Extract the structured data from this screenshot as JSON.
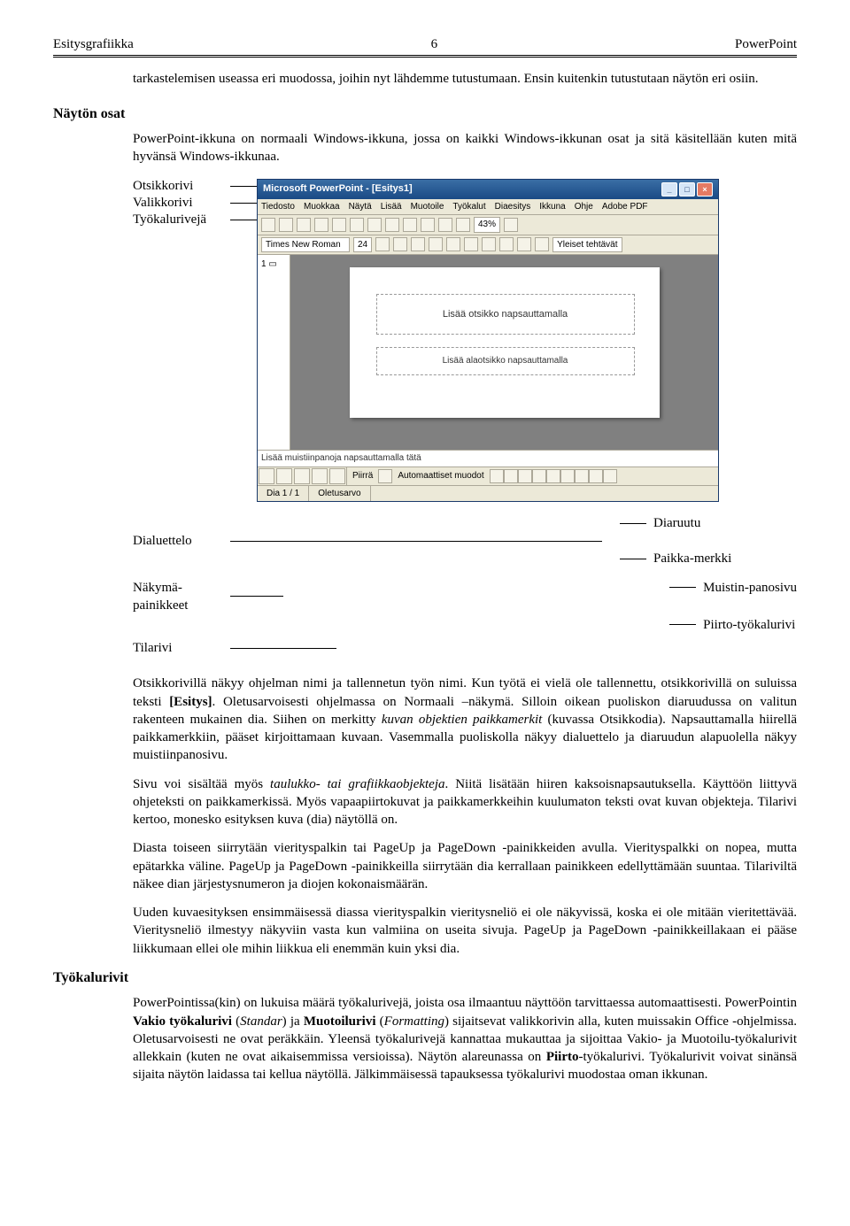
{
  "header": {
    "left": "Esitysgrafiikka",
    "center": "6",
    "right": "PowerPoint"
  },
  "intro1": "tarkastelemisen useassa eri muodossa, joihin nyt lähdemme tutustumaan. Ensin kuitenkin tutustutaan näytön eri osiin.",
  "section1": {
    "heading": "Näytön osat"
  },
  "para_window": "PowerPoint-ikkuna on normaali Windows-ikkuna, jossa on kaikki Windows-ikkunan osat ja sitä käsitellään kuten mitä hyvänsä Windows-ikkunaa.",
  "labels": {
    "otsikkorivi": "Otsikkorivi",
    "valikkorivi": "Valikkorivi",
    "tyokaluriveja": "Työkalurivejä",
    "dialuettelo": "Dialuettelo",
    "diaruutu": "Diaruutu",
    "paikkamerkki": "Paikka-merkki",
    "nakymapainikkeet": "Näkymä-painikkeet",
    "tilarivi": "Tilarivi",
    "muistinpanosivu": "Muistin-panosivu",
    "piirtotyokalurivi": "Piirto-työkalurivi"
  },
  "app": {
    "title": "Microsoft PowerPoint - [Esitys1]",
    "menu": [
      "Tiedosto",
      "Muokkaa",
      "Näytä",
      "Lisää",
      "Muotoile",
      "Työkalut",
      "Diaesitys",
      "Ikkuna",
      "Ohje",
      "Adobe PDF"
    ],
    "font": "Times New Roman",
    "size": "24",
    "zoom": "43%",
    "yleiset": "Yleiset tehtävät",
    "ph_title": "Lisää otsikko napsauttamalla",
    "ph_sub": "Lisää alaotsikko napsauttamalla",
    "notes": "Lisää muistiinpanoja napsauttamalla tätä",
    "draw_label": "Piirrä",
    "autoshapes": "Automaattiset muodot",
    "status": {
      "dia": "Dia 1 / 1",
      "layout": "Oletusarvo"
    }
  },
  "p_otsikkorivi_html": "Otsikkorivillä näkyy ohjelman nimi ja tallennetun työn nimi. Kun työtä ei vielä ole tallennettu, otsikkorivillä on suluissa teksti <b>[Esitys]</b>. Oletusarvoisesti ohjelmassa on Normaali –näkymä. Silloin oikean puoliskon diaruudussa on valitun rakenteen mukainen dia. Siihen on merkitty <i>kuvan objektien paikkamerkit</i> (kuvassa Otsikkodia). Napsauttamalla hiirellä paikkamerkkiin, pääset kirjoittamaan kuvaan. Vasemmalla puoliskolla näkyy dialuettelo ja diaruudun alapuolella näkyy muistiinpanosivu.",
  "p_sivu_html": "Sivu voi sisältää myös <i>taulukko- tai grafiikkaobjekteja</i>. Niitä lisätään hiiren kaksoisnapsautuksella. Käyttöön liittyvä ohjeteksti on paikkamerkissä. Myös vapaapiirtokuvat ja paikkamerkkeihin kuulumaton teksti ovat kuvan objekteja. Tilarivi kertoo, monesko esityksen kuva (dia) näytöllä on.",
  "p_diasta": "Diasta toiseen siirrytään vierityspalkin tai PageUp ja PageDown -painikkeiden avulla. Vierityspalkki on nopea, mutta epätarkka väline. PageUp ja PageDown -painikkeilla siirrytään dia kerrallaan painikkeen edellyttämään suuntaa. Tilariviltä näkee dian järjestysnumeron ja diojen kokonaismäärän.",
  "p_uuden": "Uuden kuvaesityksen ensimmäisessä diassa vierityspalkin vieritysneliö ei ole näkyvissä, koska ei ole mitään vieritettävää. Vieritysneliö ilmestyy näkyviin vasta kun valmiina on useita sivuja. PageUp ja PageDown -painikkeillakaan ei pääse liikkumaan ellei ole mihin liikkua eli enemmän kuin yksi dia.",
  "section2": {
    "heading": "Työkalurivit"
  },
  "p_tk_html": "PowerPointissa(kin) on lukuisa määrä työkalurivejä, joista osa ilmaantuu näyttöön tarvittaessa automaattisesti. PowerPointin <b>Vakio työkalurivi</b> (<i>Standar</i>) ja <b>Muotoilurivi</b> (<i>Formatting</i>) sijaitsevat valikkorivin alla, kuten muissakin Office -ohjelmissa. Oletusarvoisesti ne ovat peräkkäin. Yleensä työkalurivejä kannattaa mukauttaa ja sijoittaa Vakio- ja Muotoilu-työkalurivit allekkain (kuten ne ovat aikaisemmissa versioissa). Näytön alareunassa on <b>Piirto</b>-työkalurivi. Työkalurivit voivat sinänsä sijaita näytön laidassa tai kellua näytöllä. Jälkimmäisessä tapauksessa työkalurivi muodostaa oman ikkunan."
}
